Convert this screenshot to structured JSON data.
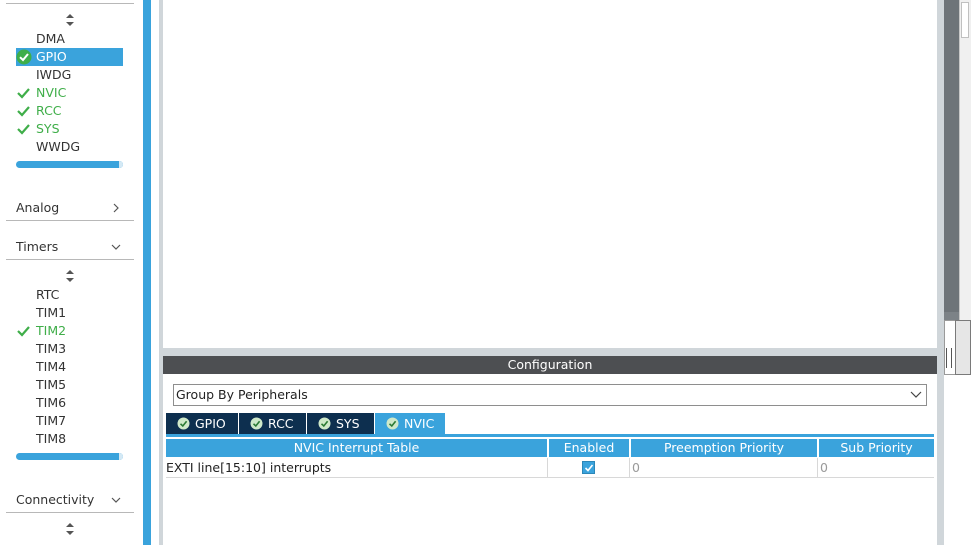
{
  "sidebar": {
    "system_core_items": [
      {
        "label": "DMA",
        "state": "none"
      },
      {
        "label": "GPIO",
        "state": "selected"
      },
      {
        "label": "IWDG",
        "state": "none"
      },
      {
        "label": "NVIC",
        "state": "checked"
      },
      {
        "label": "RCC",
        "state": "checked"
      },
      {
        "label": "SYS",
        "state": "checked"
      },
      {
        "label": "WWDG",
        "state": "none"
      }
    ],
    "categories": {
      "analog": "Analog",
      "timers": "Timers",
      "connectivity": "Connectivity"
    },
    "timer_items": [
      {
        "label": "RTC",
        "state": "none"
      },
      {
        "label": "TIM1",
        "state": "none"
      },
      {
        "label": "TIM2",
        "state": "checked"
      },
      {
        "label": "TIM3",
        "state": "none"
      },
      {
        "label": "TIM4",
        "state": "none"
      },
      {
        "label": "TIM5",
        "state": "none"
      },
      {
        "label": "TIM6",
        "state": "none"
      },
      {
        "label": "TIM7",
        "state": "none"
      },
      {
        "label": "TIM8",
        "state": "none"
      }
    ],
    "icons": {
      "sort": "sort-icon",
      "chevron_right": "chevron-right-icon",
      "chevron_down": "chevron-down-icon",
      "check": "check-icon"
    }
  },
  "config": {
    "header": "Configuration",
    "group_by": "Group By Peripherals",
    "tabs": [
      {
        "label": "GPIO",
        "active": false
      },
      {
        "label": "RCC",
        "active": false
      },
      {
        "label": "SYS",
        "active": false
      },
      {
        "label": "NVIC",
        "active": true
      }
    ],
    "table": {
      "headers": [
        "NVIC Interrupt Table",
        "Enabled",
        "Preemption Priority",
        "Sub Priority"
      ],
      "rows": [
        {
          "name": "EXTI line[15:10] interrupts",
          "enabled": true,
          "preemption": "0",
          "sub": "0"
        }
      ]
    }
  },
  "colors": {
    "accent": "#3aa3dc",
    "dark_tab": "#0d2f4f",
    "check_green": "#3fae49",
    "header_dark": "#4d4f52"
  }
}
